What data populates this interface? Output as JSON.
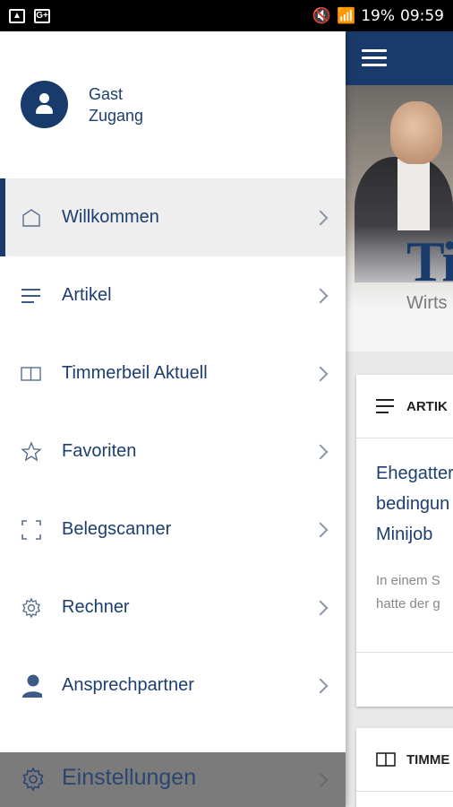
{
  "status_bar": {
    "battery": "19%",
    "time": "09:59"
  },
  "profile": {
    "name_line1": "Gast",
    "name_line2": "Zugang"
  },
  "menu": {
    "items": [
      {
        "label": "Willkommen",
        "icon": "home-icon"
      },
      {
        "label": "Artikel",
        "icon": "list-icon"
      },
      {
        "label": "Timmerbeil Aktuell",
        "icon": "book-icon"
      },
      {
        "label": "Favoriten",
        "icon": "star-icon"
      },
      {
        "label": "Belegscanner",
        "icon": "scan-frame-icon"
      },
      {
        "label": "Rechner",
        "icon": "gear-icon"
      },
      {
        "label": "Ansprechpartner",
        "icon": "person-icon"
      }
    ],
    "settings_label": "Einstellungen"
  },
  "background_app": {
    "brand": "Ti",
    "subtitle": "Wirts",
    "card1": {
      "header": "ARTIK",
      "title_lines": [
        "Ehegatter",
        "bedingun",
        "Minijob"
      ],
      "excerpt_lines": [
        "In einem S",
        "hatte der g"
      ]
    },
    "card2": {
      "header": "TIMME"
    }
  },
  "colors": {
    "primary": "#183b6b",
    "text": "#1d3e6f",
    "active_bg": "#eeeeee",
    "settings_bg": "#7b7b7b"
  }
}
